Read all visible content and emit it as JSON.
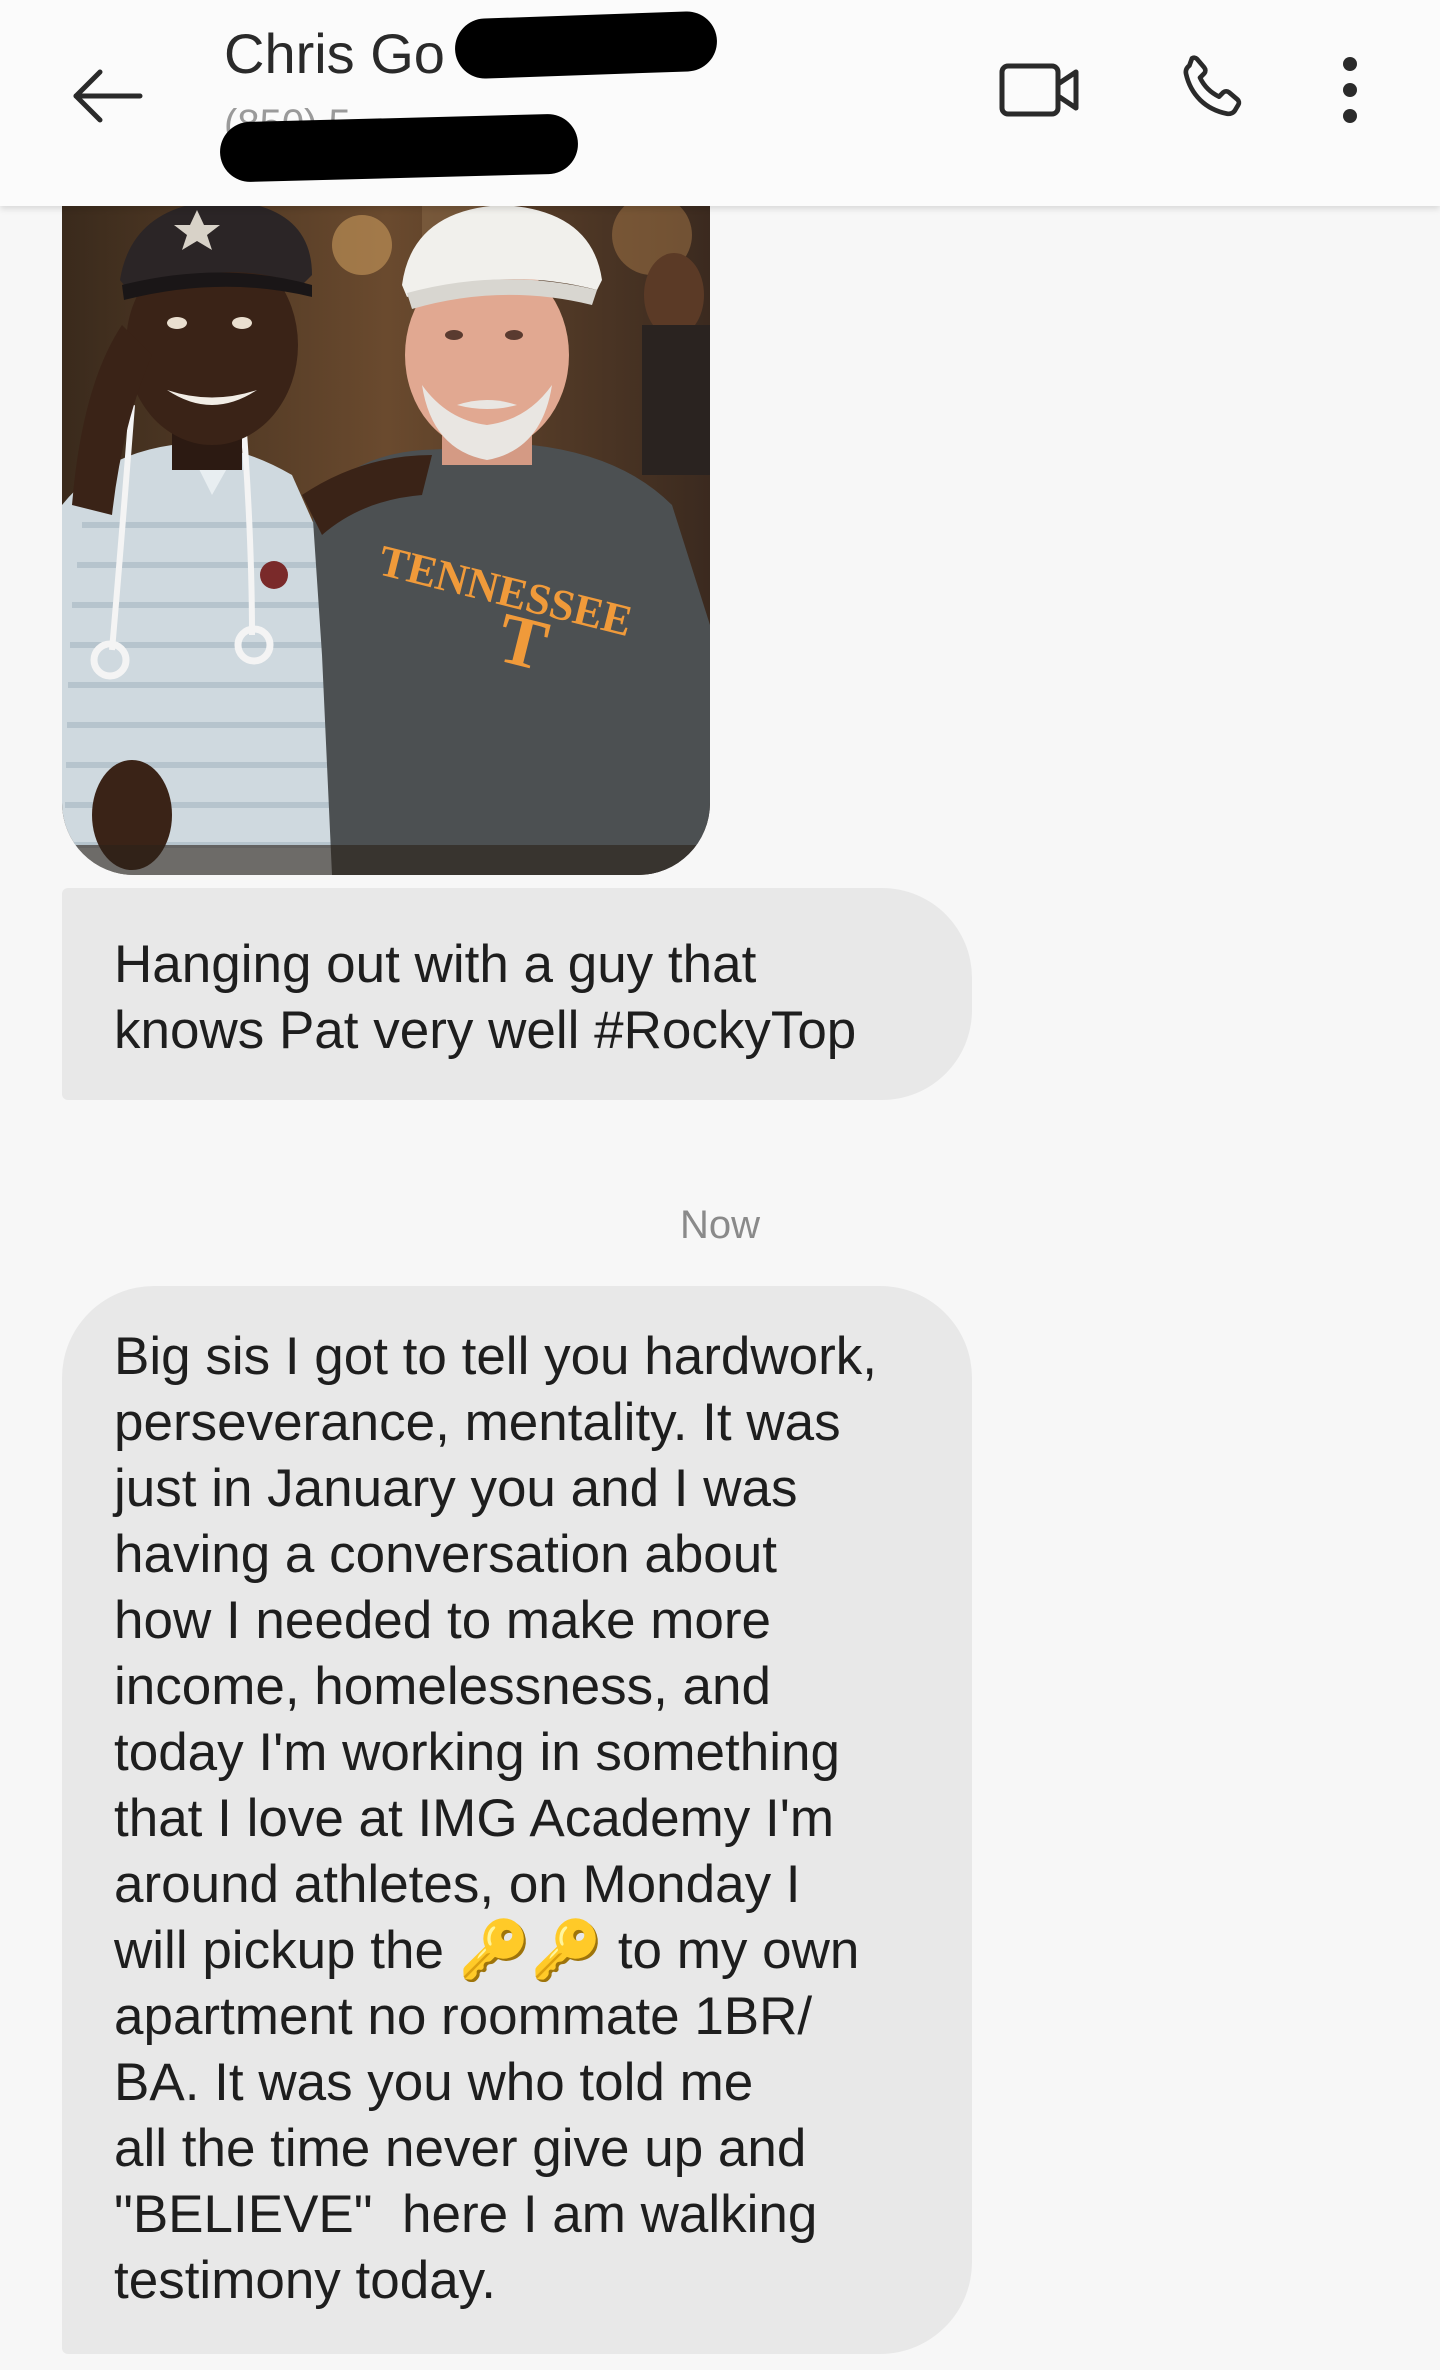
{
  "header": {
    "contact_name": "Chris Go",
    "contact_number_partial": "(850) 5",
    "back_icon": "arrow-left-icon",
    "video_icon": "video-camera-icon",
    "call_icon": "phone-icon",
    "more_icon": "more-vertical-icon"
  },
  "messages": [
    {
      "type": "image",
      "alt": "Photo of two men at a restaurant, one wearing a Tennessee T-shirt"
    },
    {
      "type": "text",
      "direction": "incoming",
      "text": "Hanging out with a guy that\nknows Pat very well #RockyTop"
    },
    {
      "type": "timestamp",
      "text": "Now"
    },
    {
      "type": "text",
      "direction": "incoming",
      "text_before_emoji": "Big sis I got to tell you hardwork,\nperseverance, mentality. It was\njust in January you and I was\nhaving a conversation about\nhow I needed to make more\nincome, homelessness, and\ntoday I'm working in something\nthat I love at IMG Academy I'm\naround athletes, on Monday I\nwill pickup the ",
      "emoji": "🔑🔑",
      "text_after_emoji": " to my own\napartment no roommate 1BR/\nBA. It was you who told me\nall the time never give up and\n\"BELIEVE\"  here I am walking\ntestimony today."
    }
  ],
  "colors": {
    "bubble_incoming": "#e8e8e8",
    "background": "#f7f7f7",
    "appbar": "#fbfbfb",
    "key_emoji": "#e7a53a"
  }
}
